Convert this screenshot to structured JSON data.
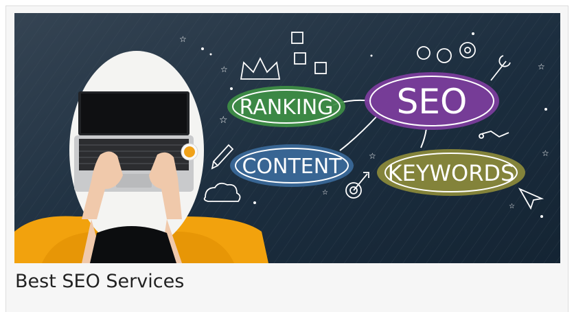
{
  "card": {
    "title": "Best SEO Services",
    "image": {
      "center_label": "SEO",
      "labels": {
        "ranking": "RANKING",
        "content": "CONTENT",
        "keywords": "KEYWORDS"
      },
      "colors": {
        "background": "#1d2f40",
        "seo_bubble": "#7b3d9c",
        "ranking_bubble": "#3f8f45",
        "content_bubble": "#3b6a9a",
        "keywords_bubble": "#8c8a3a",
        "chair": "#f2a20d",
        "chalk": "#ffffff"
      }
    }
  }
}
